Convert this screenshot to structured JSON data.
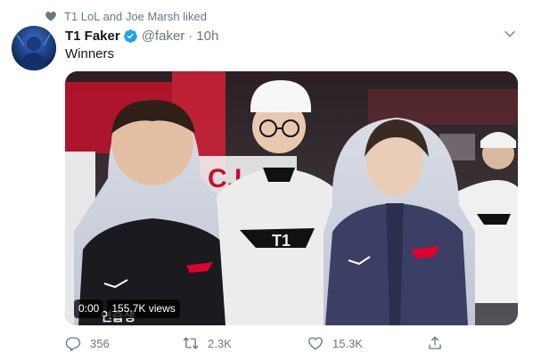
{
  "social_context": {
    "text": "T1 LoL and Joe Marsh liked",
    "icon": "heart-icon"
  },
  "tweet": {
    "display_name": "T1 Faker",
    "handle": "@faker",
    "separator": "·",
    "time": "10h",
    "text": "Winners",
    "verified": true
  },
  "media": {
    "type": "video",
    "current_time": "0:00",
    "views": "155.7K views",
    "jersey_logo": "T1",
    "left_banner_text": "연습생"
  },
  "actions": {
    "reply_count": "356",
    "retweet_count": "2.3K",
    "like_count": "15.3K"
  },
  "colors": {
    "accent": "#1da1f2",
    "muted": "#657786",
    "t1_red": "#e2012d"
  }
}
